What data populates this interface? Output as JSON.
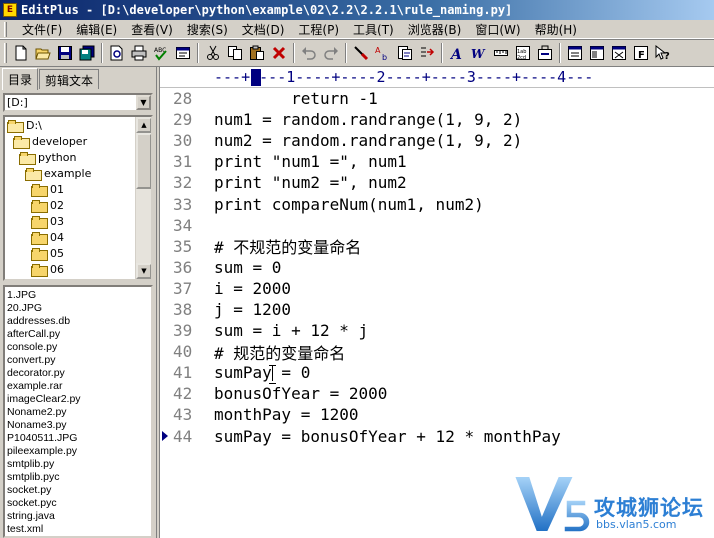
{
  "window": {
    "title": "EditPlus - [D:\\developer\\python\\example\\02\\2.2\\2.2.1\\rule_naming.py]"
  },
  "menu": [
    "文件(F)",
    "编辑(E)",
    "查看(V)",
    "搜索(S)",
    "文档(D)",
    "工程(P)",
    "工具(T)",
    "浏览器(B)",
    "窗口(W)",
    "帮助(H)"
  ],
  "toolbar": {
    "icons": [
      "new-file-icon",
      "open-file-icon",
      "save-icon",
      "save-all-icon",
      "print-preview-icon",
      "print-icon",
      "spell-check-icon",
      "browser-preview-icon",
      "cut-icon",
      "copy-icon",
      "paste-icon",
      "delete-icon",
      "undo-icon",
      "redo-icon",
      "find-icon",
      "replace-icon",
      "find-in-files-icon",
      "goto-line-icon",
      "font-icon",
      "word-wrap-icon",
      "ruler-icon",
      "line-number-icon",
      "preferences-icon",
      "toggle-directory-icon",
      "toggle-output-icon",
      "toggle-cliptext-icon",
      "fullscreen-icon",
      "help-icon"
    ]
  },
  "sidebar": {
    "tabs": [
      "目录",
      "剪辑文本"
    ],
    "drive": "[D:]",
    "folders": [
      {
        "name": "D:\\",
        "depth": 0,
        "open": true
      },
      {
        "name": "developer",
        "depth": 1,
        "open": true
      },
      {
        "name": "python",
        "depth": 2,
        "open": true
      },
      {
        "name": "example",
        "depth": 3,
        "open": true
      },
      {
        "name": "01",
        "depth": 4,
        "open": false
      },
      {
        "name": "02",
        "depth": 4,
        "open": false
      },
      {
        "name": "03",
        "depth": 4,
        "open": false
      },
      {
        "name": "04",
        "depth": 4,
        "open": false
      },
      {
        "name": "05",
        "depth": 4,
        "open": false
      },
      {
        "name": "06",
        "depth": 4,
        "open": false
      }
    ],
    "files": [
      "1.JPG",
      "20.JPG",
      "addresses.db",
      "afterCall.py",
      "console.py",
      "convert.py",
      "decorator.py",
      "example.rar",
      "imageClear2.py",
      "Noname2.py",
      "Noname3.py",
      "P1040511.JPG",
      "pileexample.py",
      "smtplib.py",
      "smtplib.pyc",
      "socket.py",
      "socket.pyc",
      "string.java",
      "test.xml"
    ]
  },
  "editor": {
    "ruler": "---+----1----+----2----+----3----+----4---",
    "current_line": 44,
    "lines": [
      {
        "n": "28",
        "text": "        return -1"
      },
      {
        "n": "29",
        "text": "num1 = random.randrange(1, 9, 2)"
      },
      {
        "n": "30",
        "text": "num2 = random.randrange(1, 9, 2)"
      },
      {
        "n": "31",
        "text": "print \"num1 =\", num1"
      },
      {
        "n": "32",
        "text": "print \"num2 =\", num2"
      },
      {
        "n": "33",
        "text": "print compareNum(num1, num2)"
      },
      {
        "n": "34",
        "text": ""
      },
      {
        "n": "35",
        "text": "# 不规范的变量命名"
      },
      {
        "n": "36",
        "text": "sum = 0"
      },
      {
        "n": "37",
        "text": "i = 2000"
      },
      {
        "n": "38",
        "text": "j = 1200"
      },
      {
        "n": "39",
        "text": "sum = i + 12 * j"
      },
      {
        "n": "40",
        "text": "# 规范的变量命名"
      },
      {
        "n": "41",
        "text": "sumPay = 0"
      },
      {
        "n": "42",
        "text": "bonusOfYear = 2000"
      },
      {
        "n": "43",
        "text": "monthPay = 1200"
      },
      {
        "n": "44",
        "text": "sumPay = bonusOfYear + 12 * monthPay"
      }
    ]
  },
  "watermark": {
    "text": "攻城狮论坛",
    "url": "bbs.vlan5.com"
  }
}
